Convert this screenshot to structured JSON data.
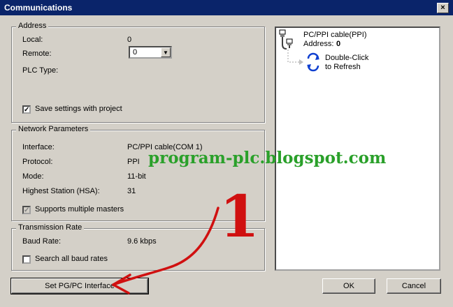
{
  "window": {
    "title": "Communications",
    "close_glyph": "×"
  },
  "address": {
    "legend": "Address",
    "local_label": "Local:",
    "local_value": "0",
    "remote_label": "Remote:",
    "remote_value": "0",
    "plc_type_label": "PLC Type:",
    "save_settings_label": "Save settings with project",
    "save_settings_checked": true
  },
  "network": {
    "legend": "Network Parameters",
    "interface_label": "Interface:",
    "interface_value": "PC/PPI cable(COM 1)",
    "protocol_label": "Protocol:",
    "protocol_value": "PPI",
    "mode_label": "Mode:",
    "mode_value": "11-bit",
    "hsa_label": "Highest Station (HSA):",
    "hsa_value": "31",
    "multi_masters_label": "Supports multiple masters",
    "multi_masters_checked": true
  },
  "transmission": {
    "legend": "Transmission Rate",
    "baud_label": "Baud Rate:",
    "baud_value": "9.6 kbps",
    "search_all_label": "Search all baud rates",
    "search_all_checked": false
  },
  "tree": {
    "cable_label": "PC/PPI cable(PPI)",
    "address_label": "Address:",
    "address_value": "0",
    "refresh_line1": "Double-Click",
    "refresh_line2": "to Refresh"
  },
  "buttons": {
    "set_pgpc": "Set PG/PC Interface",
    "ok": "OK",
    "cancel": "Cancel"
  },
  "overlay": {
    "watermark": "program-plc.blogspot.com",
    "number": "1",
    "watermark_color": "#2aa02a",
    "annotation_color": "#d01010"
  },
  "colors": {
    "titlebar": "#0a246a",
    "face": "#d4d0c8"
  },
  "icons": {
    "cable": "cable-icon",
    "refresh": "refresh-icon",
    "check": "checkmark-icon"
  }
}
